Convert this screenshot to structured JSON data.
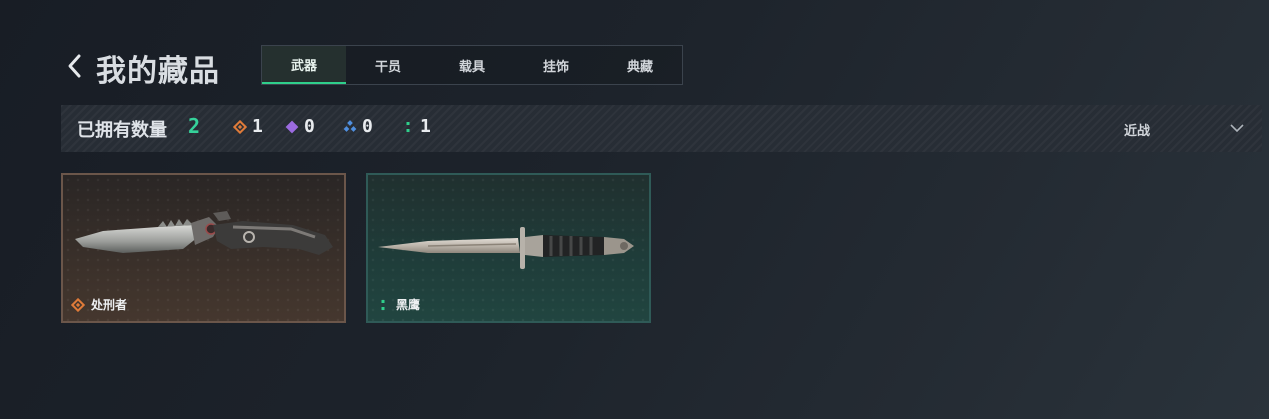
{
  "header": {
    "title": "我的藏品"
  },
  "tabs": [
    {
      "label": "武器",
      "active": true
    },
    {
      "label": "干员",
      "active": false
    },
    {
      "label": "载具",
      "active": false
    },
    {
      "label": "挂饰",
      "active": false
    },
    {
      "label": "典藏",
      "active": false
    }
  ],
  "owned": {
    "label": "已拥有数量",
    "total": "2",
    "rarities": [
      {
        "icon": "orange-diamond-icon",
        "color": "#e07b39",
        "count": "1"
      },
      {
        "icon": "purple-diamond-icon",
        "color": "#9b6be0",
        "count": "0"
      },
      {
        "icon": "blue-diamond-icon",
        "color": "#4f8fe0",
        "count": "0"
      },
      {
        "icon": "green-dots-icon",
        "color": "#2fcf8b",
        "count": "1"
      }
    ],
    "filter_label": "近战"
  },
  "items": [
    {
      "name": "处刑者",
      "rarity": "orange",
      "rarity_color": "#e07b39",
      "weapon": "combat-knife"
    },
    {
      "name": "黑鹰",
      "rarity": "green",
      "rarity_color": "#2fcf8b",
      "weapon": "bayonet-knife"
    }
  ]
}
